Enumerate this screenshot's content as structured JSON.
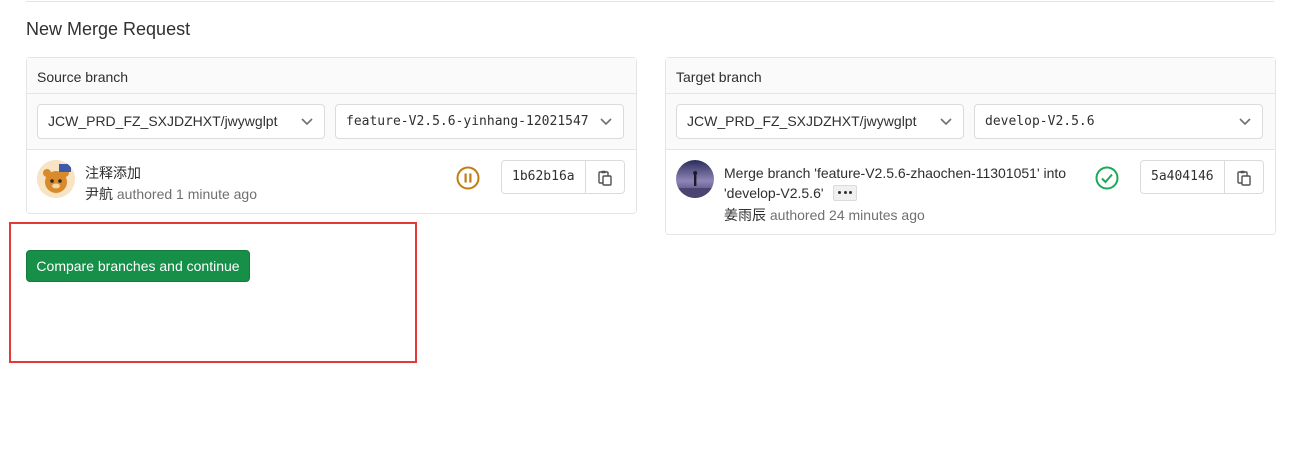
{
  "page": {
    "title": "New Merge Request"
  },
  "source": {
    "header": "Source branch",
    "project": "JCW_PRD_FZ_SXJDZHXT/jwywglpt",
    "branch": "feature-V2.5.6-yinhang-12021547",
    "commit": {
      "title": "注释添加",
      "author": "尹航",
      "meta": "authored 1 minute ago",
      "status": "paused",
      "sha": "1b62b16a"
    }
  },
  "target": {
    "header": "Target branch",
    "project": "JCW_PRD_FZ_SXJDZHXT/jwywglpt",
    "branch": "develop-V2.5.6",
    "commit": {
      "title_line1": "Merge branch 'feature-V2.5.6-zhaochen-11301051' into",
      "title_line2": "'develop-V2.5.6'",
      "author": "姜雨辰",
      "meta": "authored 24 minutes ago",
      "status": "passed",
      "sha": "5a404146"
    }
  },
  "actions": {
    "compare_label": "Compare branches and continue"
  },
  "colors": {
    "primary": "#168f48",
    "paused": "#c17d10",
    "passed": "#1aaa55",
    "annotation": "#e23a3a"
  },
  "icons": [
    "chevron-down-icon",
    "copy-icon",
    "pause-status-icon",
    "check-status-icon",
    "ellipsis-icon"
  ]
}
